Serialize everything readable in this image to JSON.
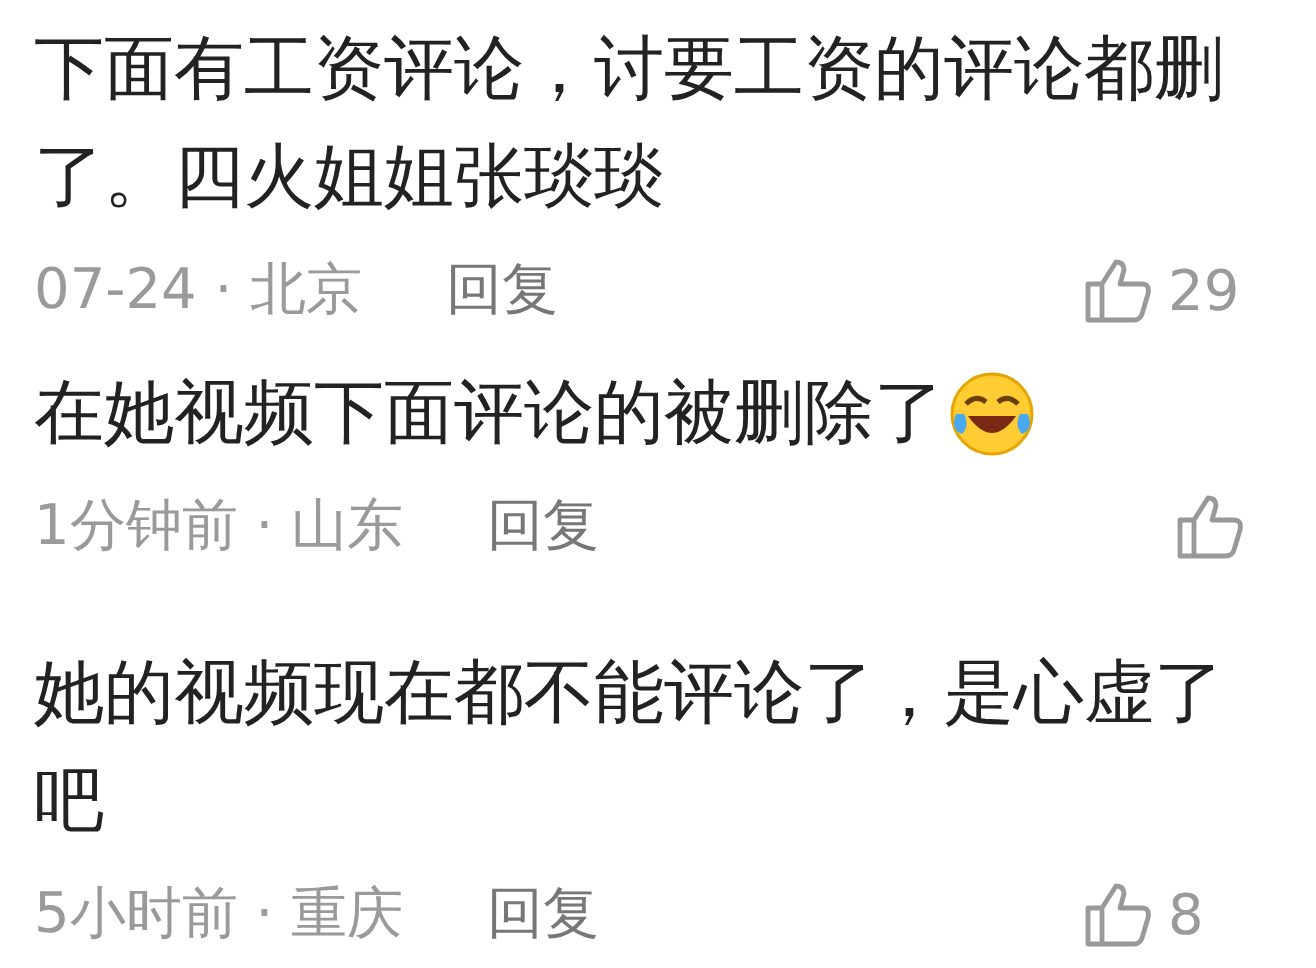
{
  "comments": [
    {
      "lines": [
        "下面有工资评论，讨要工资的评论都删",
        "了。四火姐姐张琰琰"
      ],
      "emoji": false,
      "meta": "07-24 · 北京",
      "reply": "回复",
      "likes": "29"
    },
    {
      "lines": [
        "在她视频下面评论的被删除了"
      ],
      "emoji": true,
      "meta": "1分钟前 · 山东",
      "reply": "回复"
    },
    {
      "lines": [
        "她的视频现在都不能评论了，是心虚了",
        "吧"
      ],
      "emoji": false,
      "meta": "5小时前 · 重庆",
      "reply": "回复",
      "likes": "8"
    }
  ]
}
